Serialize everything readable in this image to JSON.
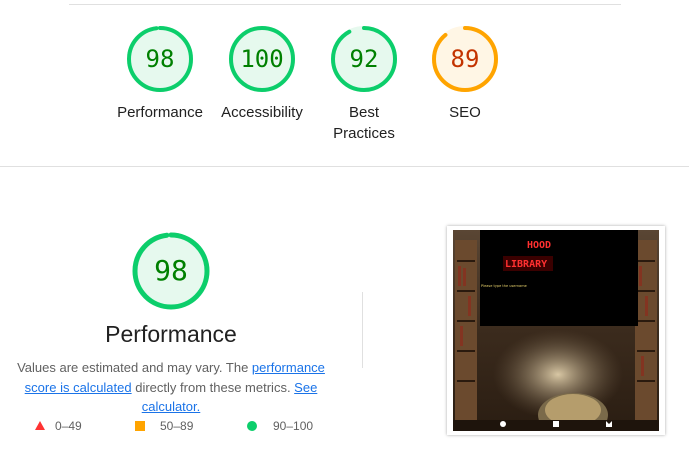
{
  "categories": [
    {
      "label": "Performance",
      "score": "98",
      "fraction": 0.98,
      "status": "pass"
    },
    {
      "label": "Accessibility",
      "score": "100",
      "fraction": 1.0,
      "status": "pass"
    },
    {
      "label": "Best Practices",
      "score": "92",
      "fraction": 0.92,
      "status": "pass"
    },
    {
      "label": "SEO",
      "score": "89",
      "fraction": 0.89,
      "status": "average"
    }
  ],
  "performance": {
    "score": "98",
    "fraction": 0.98,
    "title": "Performance",
    "desc_prefix": "Values are estimated and may vary. The ",
    "desc_link": "performance score is calculated",
    "desc_middle": " directly from these metrics. ",
    "desc_link2": "See calculator."
  },
  "legend": [
    {
      "range": "0–49",
      "color": "#ff3333"
    },
    {
      "range": "50–89",
      "color": "#ffa400"
    },
    {
      "range": "90–100",
      "color": "#0cce6b"
    }
  ],
  "colors": {
    "pass": "#0cce6b",
    "pass_text": "#008000",
    "pass_bg": "#e6f9ee",
    "average": "#ffa400",
    "average_text": "#c33300",
    "average_bg": "#fff6e5"
  },
  "screenshot": {
    "title_line1": "HOOD",
    "title_line2": "LIBRARY",
    "prompt": "Please type the username",
    "icons": [
      "github-icon",
      "linkedin-icon",
      "website-icon"
    ]
  }
}
